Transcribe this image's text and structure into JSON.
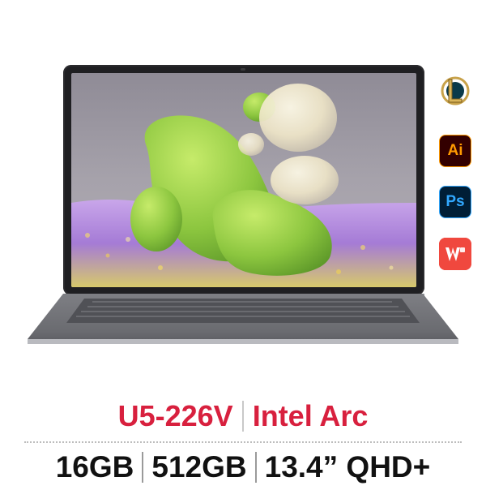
{
  "product": {
    "spec_line_1": {
      "cpu": "U5-226V",
      "gpu": "Intel Arc"
    },
    "spec_line_2": {
      "ram": "16GB",
      "storage": "512GB",
      "display": "13.4” QHD+"
    }
  },
  "app_icons": [
    {
      "name": "league-of-legends-icon",
      "label": "L"
    },
    {
      "name": "adobe-illustrator-icon",
      "label": "Ai"
    },
    {
      "name": "adobe-photoshop-icon",
      "label": "Ps"
    },
    {
      "name": "wps-office-icon",
      "label": "W"
    }
  ],
  "colors": {
    "accent_red": "#d8203e",
    "spec_dark": "#111111"
  }
}
